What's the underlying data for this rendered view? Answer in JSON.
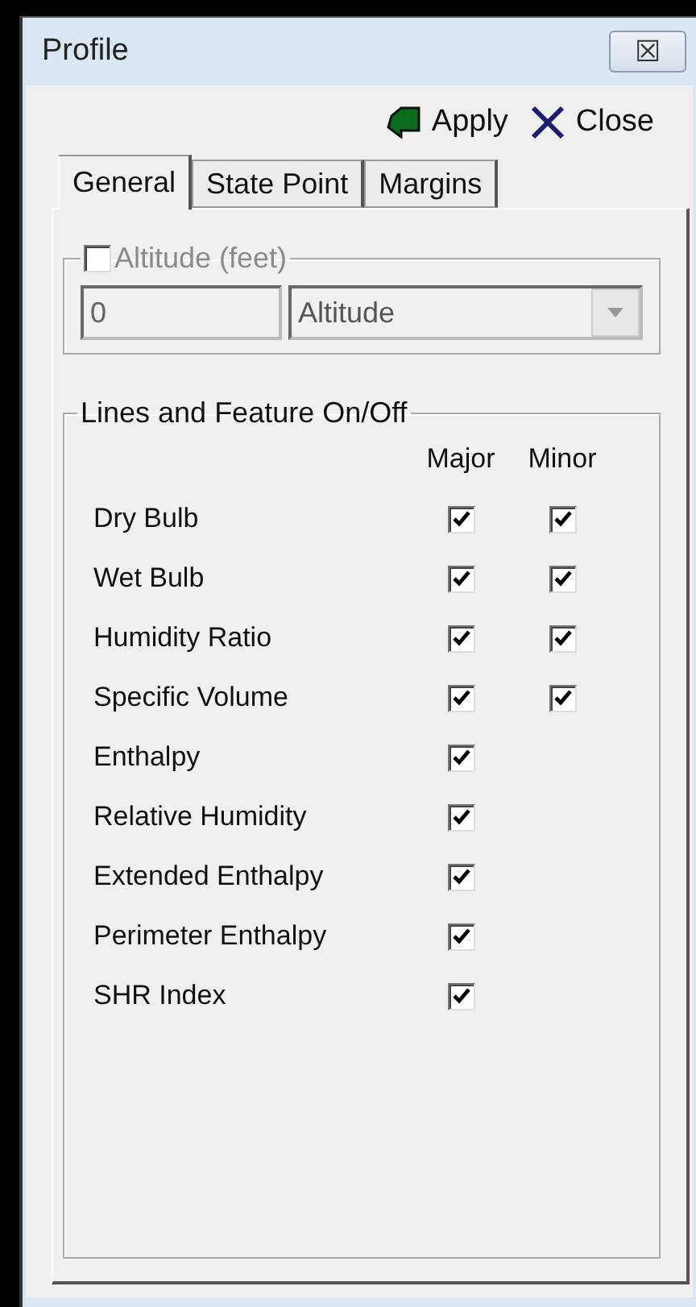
{
  "window": {
    "title": "Profile",
    "close_glyph": "☒"
  },
  "toolbar": [
    {
      "kind": "apply",
      "label": "Apply"
    },
    {
      "kind": "close",
      "label": "Close"
    }
  ],
  "tabs": [
    {
      "label": "General",
      "selected": true
    },
    {
      "label": "State Point",
      "selected": false
    },
    {
      "label": "Margins",
      "selected": false
    }
  ],
  "altitude": {
    "label": "Altitude (feet)",
    "checked": false,
    "disabled": true,
    "value": "0",
    "unit": "Altitude"
  },
  "lines": {
    "title": "Lines and Feature On/Off",
    "columns": [
      "Major",
      "Minor"
    ],
    "rows": [
      {
        "label": "Dry Bulb",
        "major": true,
        "minor": true
      },
      {
        "label": "Wet Bulb",
        "major": true,
        "minor": true
      },
      {
        "label": "Humidity Ratio",
        "major": true,
        "minor": true
      },
      {
        "label": "Specific Volume",
        "major": true,
        "minor": true
      },
      {
        "label": "Enthalpy",
        "major": true
      },
      {
        "label": "Relative Humidity",
        "major": true
      },
      {
        "label": "Extended Enthalpy",
        "major": true
      },
      {
        "label": "Perimeter Enthalpy",
        "major": true
      },
      {
        "label": "SHR Index",
        "major": true
      }
    ]
  }
}
